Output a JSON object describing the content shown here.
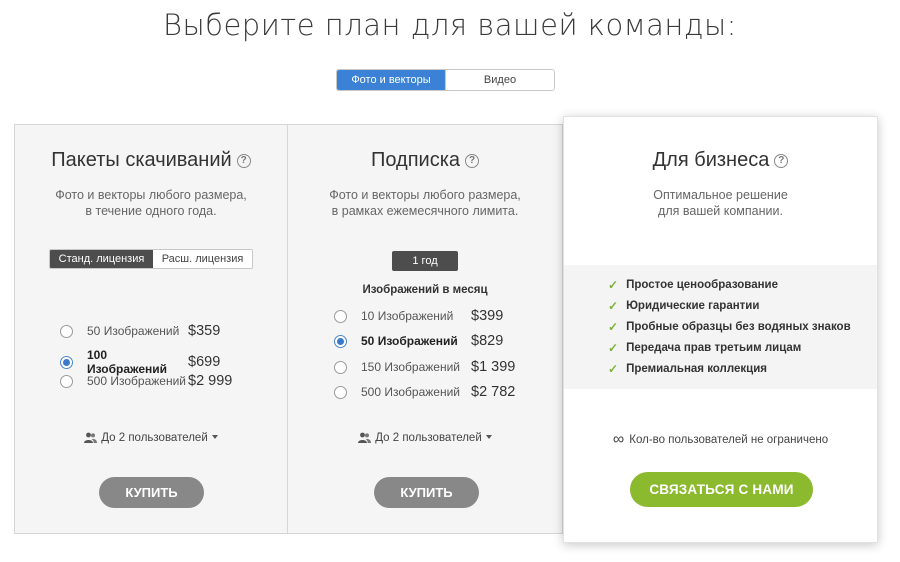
{
  "page": {
    "title": "Выберите план для вашей команды:"
  },
  "media_toggle": {
    "options": [
      "Фото и векторы",
      "Видео"
    ],
    "active": 0
  },
  "cards": {
    "packs": {
      "title": "Пакеты скачиваний",
      "help": "?",
      "desc_line1": "Фото и векторы любого размера,",
      "desc_line2": "в течение одного года.",
      "license_options": [
        "Станд. лицензия",
        "Расш. лицензия"
      ],
      "options": [
        {
          "count": "50",
          "unit": "Изображений",
          "price": "$359",
          "selected": false
        },
        {
          "count": "100",
          "unit": "Изображений",
          "price": "$699",
          "selected": true
        },
        {
          "count": "500",
          "unit": "Изображений",
          "price": "$2 999",
          "selected": false
        }
      ],
      "users": "До 2 пользователей",
      "buy": "КУПИТЬ"
    },
    "subscription": {
      "title": "Подписка",
      "help": "?",
      "desc_line1": "Фото и векторы любого размера,",
      "desc_line2": "в рамках ежемесячного лимита.",
      "term": "1 год",
      "per_month": "Изображений в месяц",
      "options": [
        {
          "count": "10",
          "unit": "Изображений",
          "price": "$399",
          "selected": false
        },
        {
          "count": "50",
          "unit": "Изображений",
          "price": "$829",
          "selected": true
        },
        {
          "count": "150",
          "unit": "Изображений",
          "price": "$1 399",
          "selected": false
        },
        {
          "count": "500",
          "unit": "Изображений",
          "price": "$2 782",
          "selected": false
        }
      ],
      "users": "До 2 пользователей",
      "buy": "КУПИТЬ"
    },
    "business": {
      "title": "Для бизнеса",
      "help": "?",
      "desc_line1": "Оптимальное решение",
      "desc_line2": "для вашей компании.",
      "features": [
        "Простое ценообразование",
        "Юридические гарантии",
        "Пробные образцы без водяных знаков",
        "Передача прав третьим лицам",
        "Премиальная коллекция"
      ],
      "unlimited": "Кол-во пользователей не ограничено",
      "contact": "СВЯЗАТЬСЯ С НАМИ"
    }
  },
  "colors": {
    "accent_blue": "#3b82d6",
    "dark_toggle": "#4d4d4d",
    "buy_gray": "#888888",
    "contact_green": "#8bba2e",
    "check_green": "#7cb13a"
  },
  "icons": [
    "help-icon",
    "users-icon",
    "caret-down-icon",
    "check-icon",
    "infinity-icon"
  ]
}
